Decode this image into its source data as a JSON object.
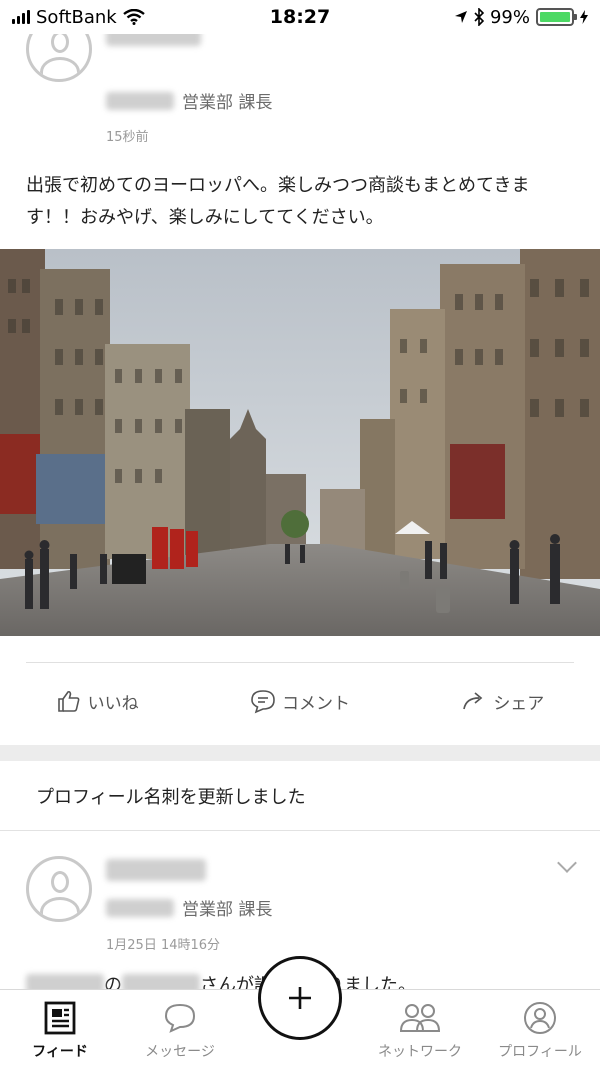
{
  "status_bar": {
    "carrier": "SoftBank",
    "time": "18:27",
    "battery": "99%"
  },
  "post1": {
    "role": "営業部 課長",
    "time": "15秒前",
    "text": "出張で初めてのヨーロッパへ。楽しみつつ商談もまとめてきます！！おみやげ、楽しみにしててください。",
    "actions": {
      "like": "いいね",
      "comment": "コメント",
      "share": "シェア"
    }
  },
  "post2": {
    "header": "プロフィール名刺を更新しました",
    "role": "営業部 課長",
    "time": "1月25日 14時16分",
    "text_connector": "の",
    "text_tail": "さんが課長になりました。"
  },
  "tabs": {
    "feed": "フィード",
    "messages": "メッセージ",
    "network": "ネットワーク",
    "profile": "プロフィール"
  },
  "colors": {
    "accent": "#111111",
    "battery": "#4cd964",
    "muted": "#8a8a8a"
  }
}
